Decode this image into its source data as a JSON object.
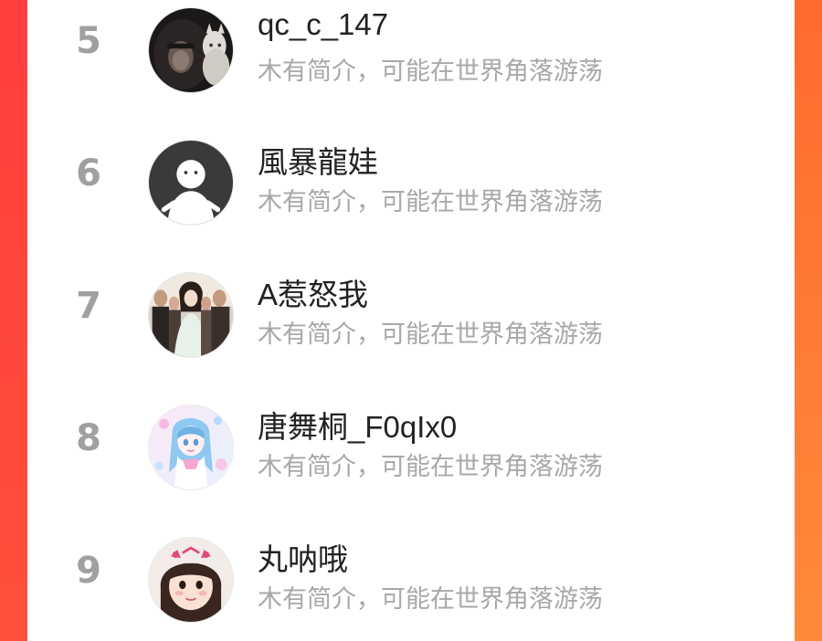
{
  "list": {
    "items": [
      {
        "rank": "5",
        "name": "qc_c_147",
        "bio": "木有简介，可能在世界角落游荡",
        "avatar_icon": "dark-hood-cat-avatar-icon"
      },
      {
        "rank": "6",
        "name": "風暴龍娃",
        "bio": "木有简介，可能在世界角落游荡",
        "avatar_icon": "default-person-avatar-icon"
      },
      {
        "rank": "7",
        "name": "A惹怒我",
        "bio": "木有简介，可能在世界角落游荡",
        "avatar_icon": "group-photo-avatar-icon"
      },
      {
        "rank": "8",
        "name": "唐舞桐_F0qIx0",
        "bio": "木有简介，可能在世界角落游荡",
        "avatar_icon": "anime-girl-avatar-icon"
      },
      {
        "rank": "9",
        "name": "丸呐哦",
        "bio": "木有简介，可能在世界角落游荡",
        "avatar_icon": "child-photo-avatar-icon"
      }
    ]
  },
  "colors": {
    "background_gradient_top": "#ff4a3a",
    "background_gradient_bottom": "#ff8a3a",
    "panel": "#ffffff",
    "rank_text": "#a0a0a0",
    "name_text": "#222222",
    "bio_text": "#a8a8a8"
  }
}
